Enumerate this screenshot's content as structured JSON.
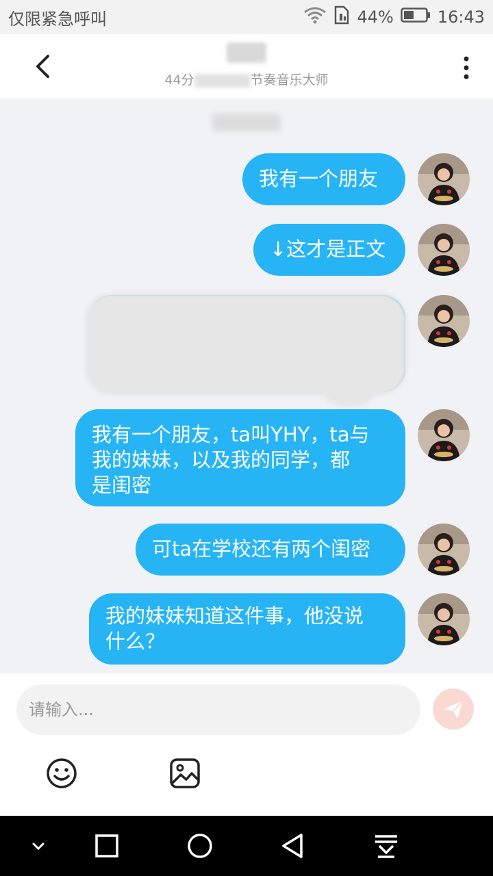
{
  "status_bar": {
    "carrier_text": "仅限紧急呼叫",
    "battery_percent": "44%",
    "time": "16:43"
  },
  "header": {
    "subtitle_prefix": "44分",
    "subtitle_suffix": "节奏音乐大师"
  },
  "messages": [
    {
      "text": "我有一个朋友"
    },
    {
      "text": "↓这才是正文"
    },
    {
      "text": ""
    },
    {
      "text_lines": [
        "我有一个朋友，ta叫YHY，ta与",
        "我的妹妹，以及我的同学，都",
        "是闺密"
      ]
    },
    {
      "text": "可ta在学校还有两个闺密"
    },
    {
      "text_lines": [
        "我的妹妹知道这件事，他没说",
        "什么？"
      ]
    }
  ],
  "input": {
    "placeholder": "请输入..."
  },
  "icons": {
    "back": "chevron-left-icon",
    "more": "more-vertical-icon",
    "send": "send-icon",
    "emoji": "emoji-icon",
    "image": "image-icon"
  },
  "colors": {
    "bubble": "#27b4f4",
    "chat_bg": "#f1f2f6",
    "send_btn": "#fbd9d3"
  }
}
